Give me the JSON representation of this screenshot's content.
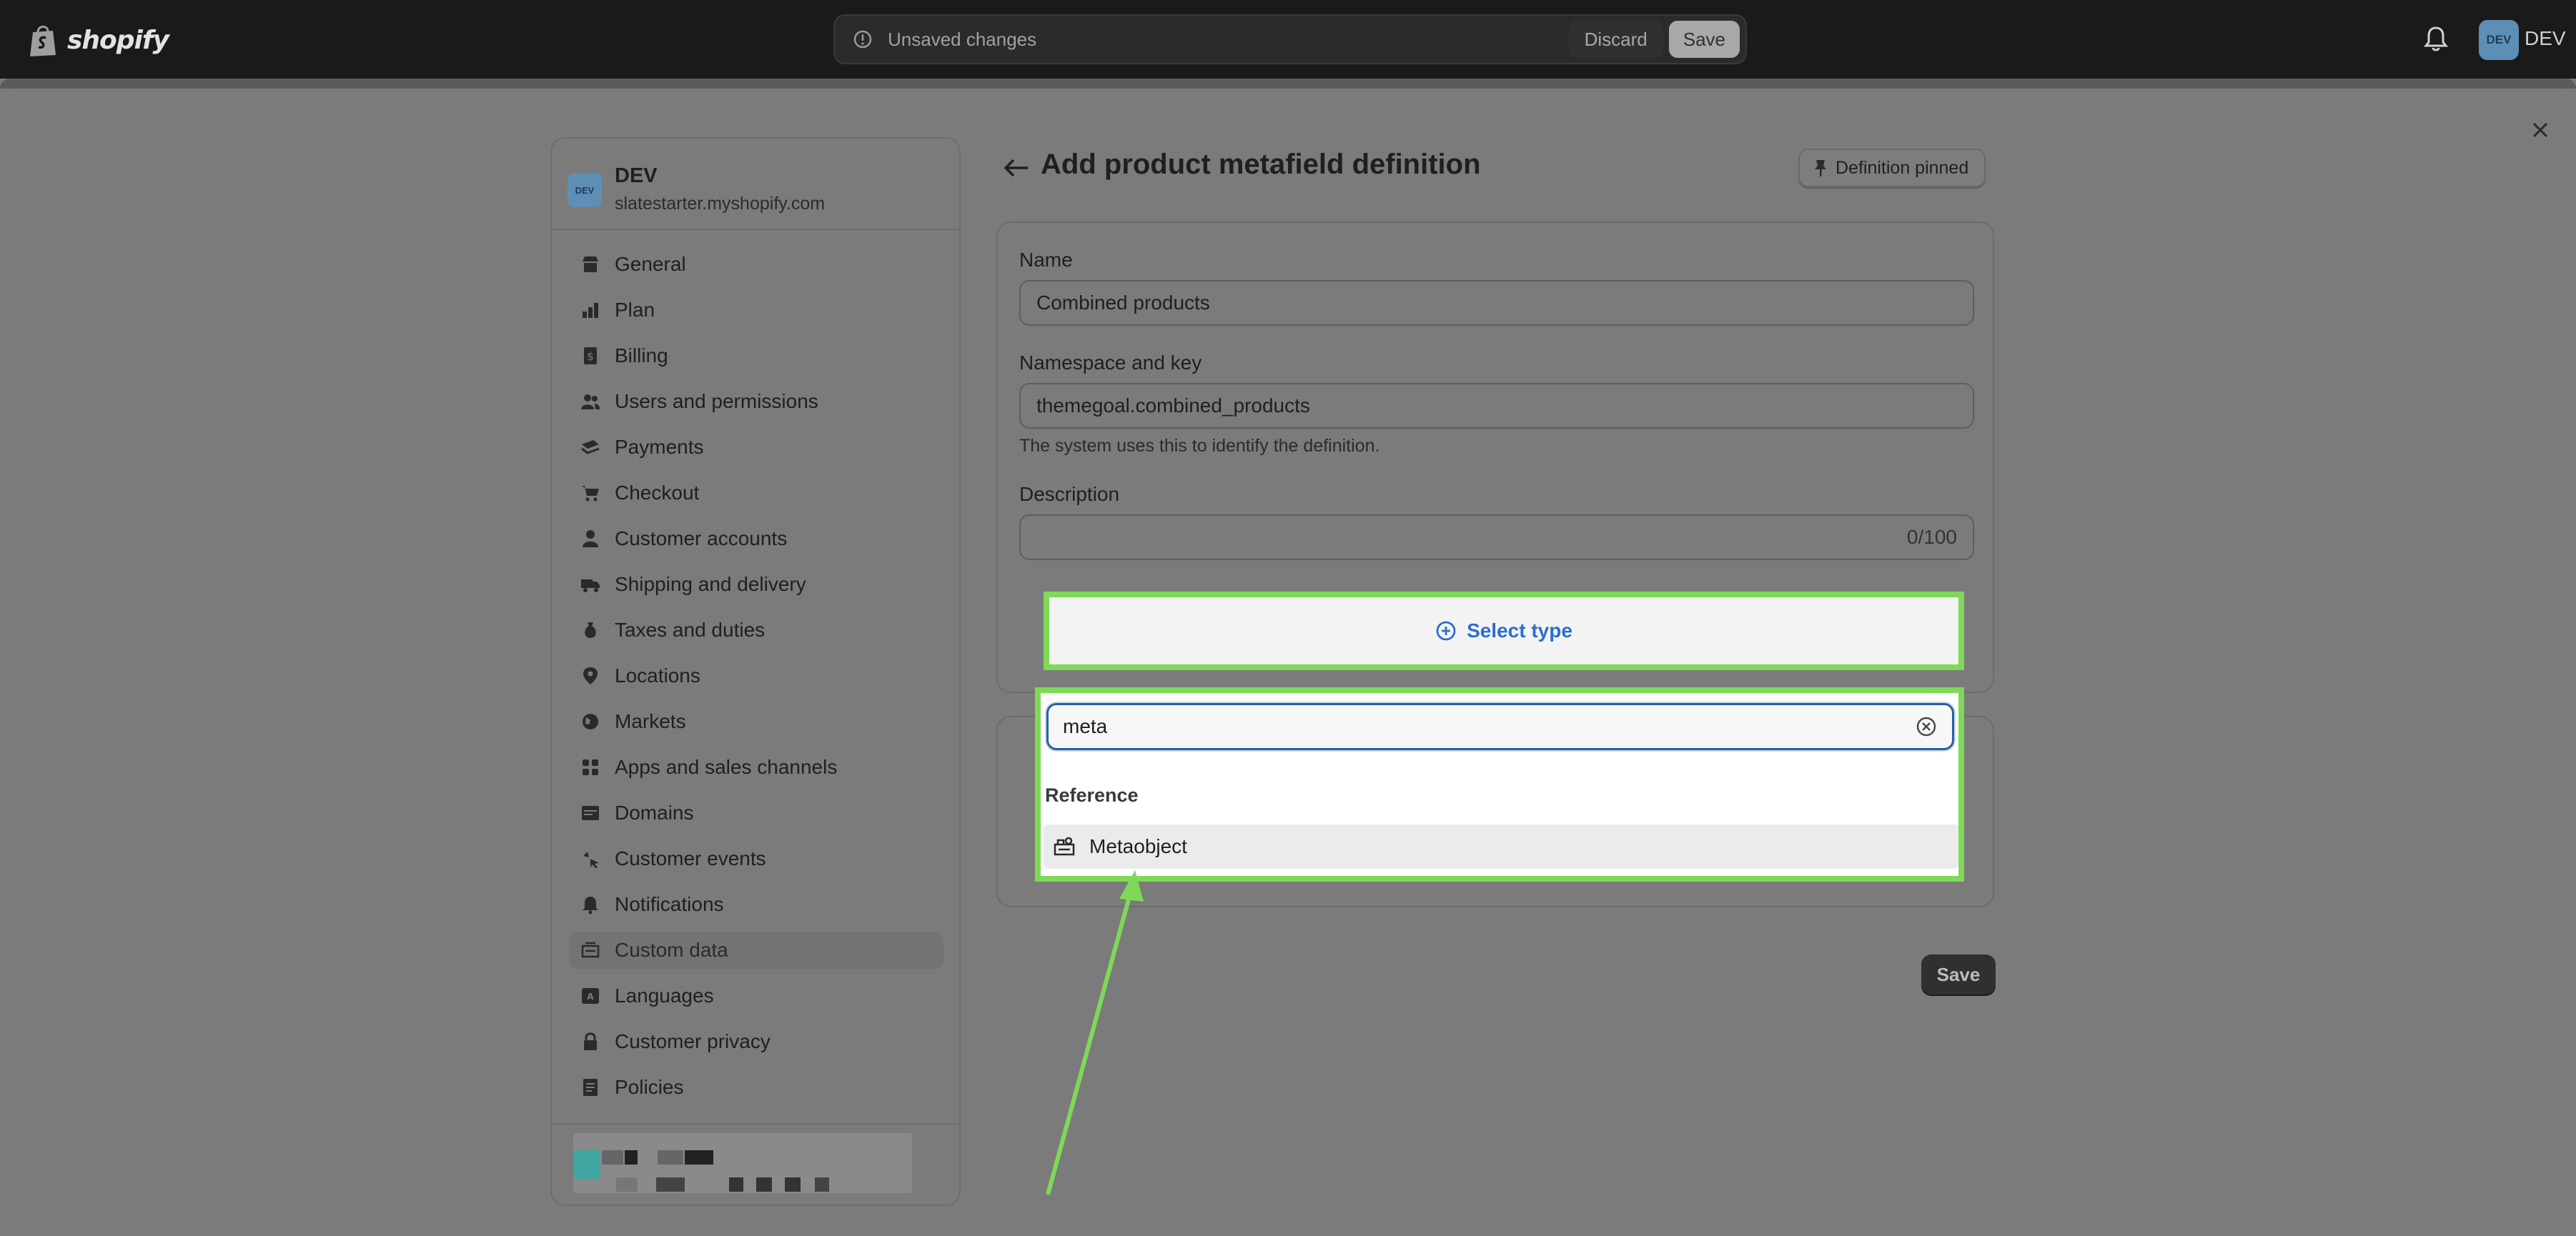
{
  "topbar": {
    "logo_text": "shopify",
    "unsaved_text": "Unsaved changes",
    "discard_label": "Discard",
    "save_label": "Save",
    "avatar_initials": "DEV",
    "store_label": "DEV"
  },
  "sidebar": {
    "store_avatar": "DEV",
    "store_name": "DEV",
    "store_domain": "slatestarter.myshopify.com",
    "items": [
      {
        "label": "General",
        "icon": "store-icon"
      },
      {
        "label": "Plan",
        "icon": "plan-icon"
      },
      {
        "label": "Billing",
        "icon": "billing-icon"
      },
      {
        "label": "Users and permissions",
        "icon": "users-icon"
      },
      {
        "label": "Payments",
        "icon": "payments-icon"
      },
      {
        "label": "Checkout",
        "icon": "cart-icon"
      },
      {
        "label": "Customer accounts",
        "icon": "person-icon"
      },
      {
        "label": "Shipping and delivery",
        "icon": "truck-icon"
      },
      {
        "label": "Taxes and duties",
        "icon": "tax-icon"
      },
      {
        "label": "Locations",
        "icon": "location-icon"
      },
      {
        "label": "Markets",
        "icon": "globe-icon"
      },
      {
        "label": "Apps and sales channels",
        "icon": "apps-icon"
      },
      {
        "label": "Domains",
        "icon": "domain-icon"
      },
      {
        "label": "Customer events",
        "icon": "events-icon"
      },
      {
        "label": "Notifications",
        "icon": "bell-icon"
      },
      {
        "label": "Custom data",
        "icon": "custom-data-icon"
      },
      {
        "label": "Languages",
        "icon": "language-icon"
      },
      {
        "label": "Customer privacy",
        "icon": "lock-icon"
      },
      {
        "label": "Policies",
        "icon": "policy-icon"
      }
    ],
    "active_item": "Custom data"
  },
  "main": {
    "title": "Add product metafield definition",
    "pinned_label": "Definition pinned",
    "name_label": "Name",
    "name_value": "Combined products",
    "ns_label": "Namespace and key",
    "ns_value": "themegoal.combined_products",
    "ns_help": "The system uses this to identify the definition.",
    "desc_label": "Description",
    "desc_value": "",
    "desc_counter": "0/100",
    "select_type_label": "Select type",
    "save_label": "Save"
  },
  "dropdown": {
    "search_value": "meta",
    "section_heading": "Reference",
    "options": [
      {
        "label": "Metaobject",
        "icon": "metaobject-icon"
      }
    ]
  },
  "colors": {
    "highlight": "#7ed957",
    "link": "#2c6ecb",
    "topbar": "#1a1a1a"
  }
}
